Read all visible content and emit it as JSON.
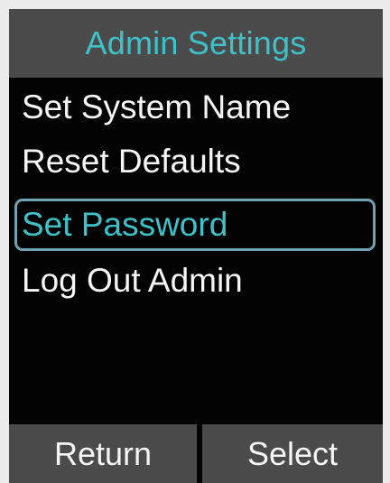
{
  "screen": {
    "title": "Admin Settings",
    "colors": {
      "accent": "#3ec1c9",
      "background": "#030303",
      "bar": "#4b4b4b",
      "text": "#f5f5f5",
      "selection_border": "#6fa3b3"
    }
  },
  "menu": {
    "items": [
      {
        "label": "Set System Name",
        "selected": false
      },
      {
        "label": "Reset Defaults",
        "selected": false
      },
      {
        "label": "Set Password",
        "selected": true
      },
      {
        "label": "Log Out Admin",
        "selected": false
      }
    ]
  },
  "softkeys": {
    "left_label": "Return",
    "right_label": "Select"
  }
}
